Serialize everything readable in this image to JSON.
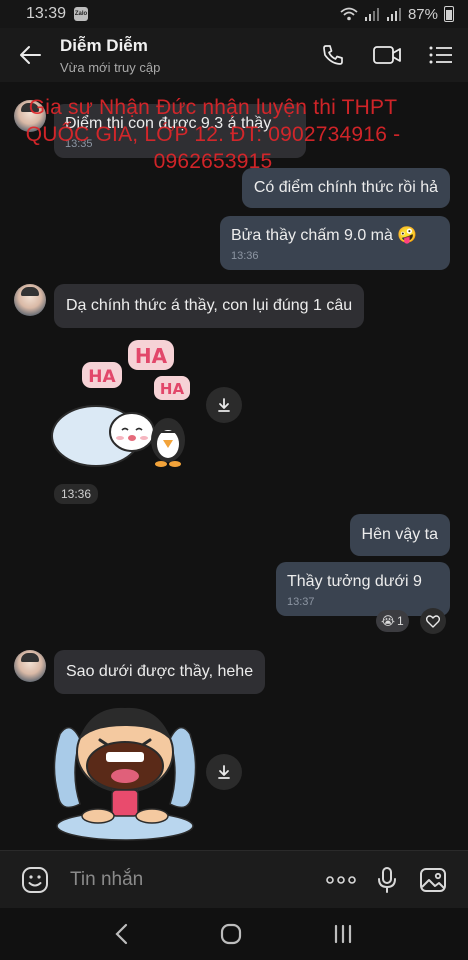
{
  "status_bar": {
    "time": "13:39",
    "app_badge": "Zalo",
    "battery": "87%"
  },
  "header": {
    "name": "Diễm Diễm",
    "status": "Vừa mới truy cập"
  },
  "watermark": "Gia sư Nhận Đức nhận luyện thi THPT QUỐC GIA, LỚP 12. ĐT: 0902734916 - 0962653915",
  "messages": [
    {
      "text": "Điểm thi con được 9.3 á thầy",
      "time": "13:35"
    },
    {
      "text": "Có điểm chính thức rồi hả"
    },
    {
      "text": "Bửa thầy chấm 9.0 mà 🤪",
      "time": "13:36"
    },
    {
      "text": "Dạ chính thức á thầy, con lụi đúng 1 câu"
    },
    {
      "sticker": "HA HA HA",
      "time": "13:36"
    },
    {
      "text": "Hên vậy ta"
    },
    {
      "text": "Thầy tưởng dưới 9",
      "time": "13:37",
      "reaction": {
        "emoji": "😭",
        "count": "1"
      }
    },
    {
      "text": "Sao dưới được thầy, hehe"
    }
  ],
  "input": {
    "placeholder": "Tin nhắn"
  },
  "colors": {
    "background": "#121212",
    "incoming": "#2f2f33",
    "outgoing": "#3a4350",
    "watermark": "#e0262a"
  }
}
